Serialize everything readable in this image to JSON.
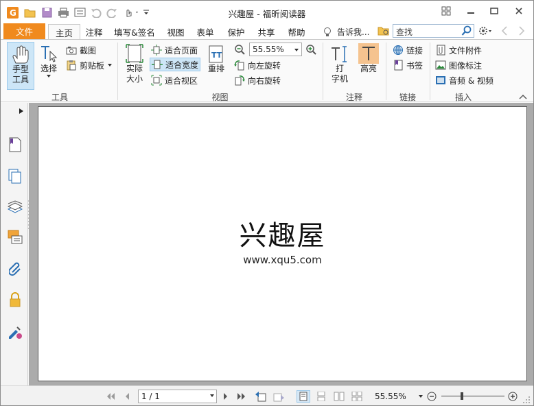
{
  "window": {
    "title": "兴趣屋 - 福昕阅读器"
  },
  "menu": {
    "file": "文件",
    "tabs": [
      "主页",
      "注释",
      "填写&签名",
      "视图",
      "表单",
      "保护",
      "共享",
      "帮助"
    ],
    "tell_me": "告诉我...",
    "search_placeholder": "查找"
  },
  "ribbon": {
    "tools": {
      "hand": "手型\n工具",
      "hand_l1": "手型",
      "hand_l2": "工具",
      "select": "选择",
      "snapshot": "截图",
      "clipboard": "剪贴板",
      "label": "工具"
    },
    "view": {
      "actual_l1": "实际",
      "actual_l2": "大小",
      "fit_page": "适合页面",
      "fit_width": "适合宽度",
      "fit_visible": "适合视区",
      "reflow": "重排",
      "zoom": "55.55%",
      "rotate_left": "向左旋转",
      "rotate_right": "向右旋转",
      "label": "视图"
    },
    "comment": {
      "typewriter_l1": "打",
      "typewriter_l2": "字机",
      "highlight": "高亮",
      "label": "注释"
    },
    "links": {
      "link": "链接",
      "bookmark": "书签",
      "label": "链接"
    },
    "insert": {
      "attachment": "文件附件",
      "image": "图像标注",
      "av": "音频 & 视频",
      "label": "插入"
    }
  },
  "document": {
    "title": "兴趣屋",
    "url": "www.xqu5.com"
  },
  "status": {
    "page": "1 / 1",
    "zoom": "55.55%",
    "zoom_level": 0.3
  },
  "colors": {
    "accent": "#f08a1e",
    "selection": "#cde6f7",
    "highlight": "#f5c38f"
  }
}
